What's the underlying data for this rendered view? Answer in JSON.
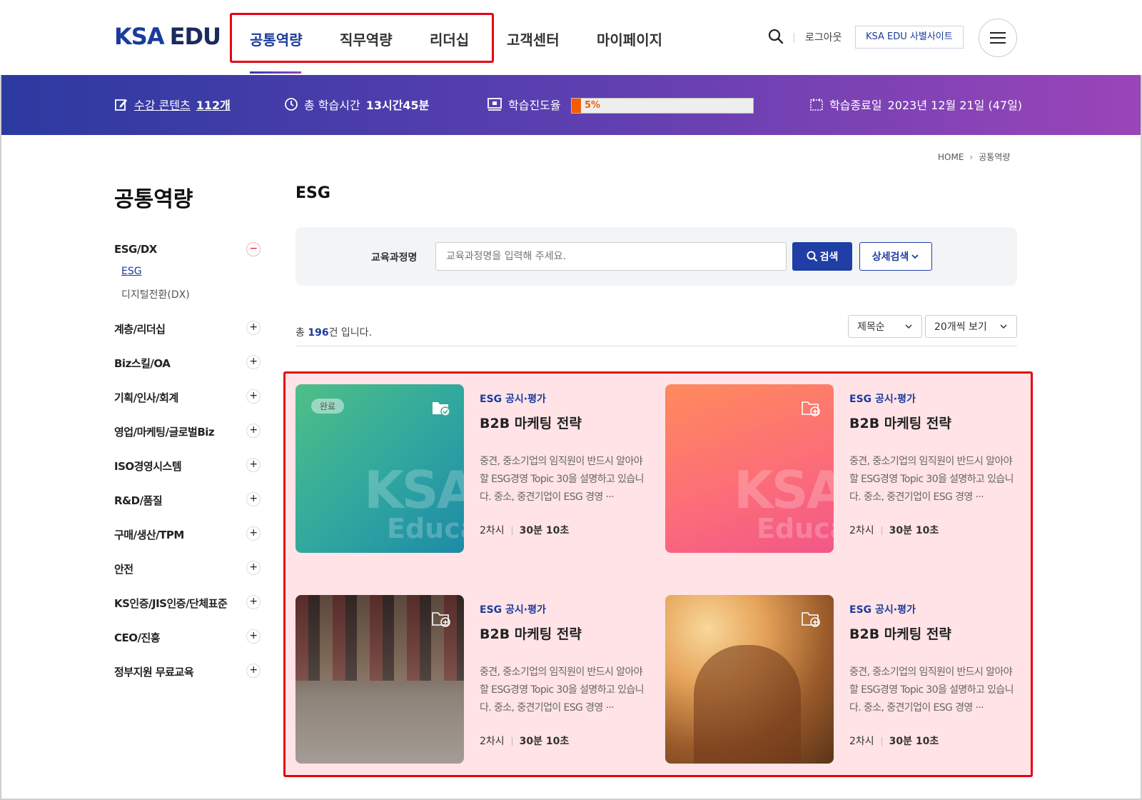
{
  "logo": {
    "ksa": "KSA",
    "edu": "EDU"
  },
  "gnb": [
    {
      "label": "공통역량",
      "active": true
    },
    {
      "label": "직무역량",
      "active": false
    },
    {
      "label": "리더십",
      "active": false
    },
    {
      "label": "고객센터",
      "active": false
    },
    {
      "label": "마이페이지",
      "active": false
    }
  ],
  "header": {
    "logout": "로그아웃",
    "family_site": "KSA EDU 사별사이트"
  },
  "banner": {
    "contents_label": "수강 콘텐츠",
    "contents_value": "112개",
    "time_label": "총 학습시간",
    "time_value": "13시간45분",
    "progress_label": "학습진도율",
    "progress_pct": "5%",
    "progress_value": 0.05,
    "end_label": "학습종료일",
    "end_value": "2023년 12월 21일 (47일)"
  },
  "breadcrumb": {
    "home": "HOME",
    "current": "공통역량"
  },
  "sidebar": {
    "title": "공통역량",
    "items": [
      {
        "label": "ESG/DX",
        "expanded": true,
        "subs": [
          {
            "label": "ESG",
            "on": true
          },
          {
            "label": "디지털전환(DX)",
            "on": false
          }
        ]
      },
      {
        "label": "계층/리더십"
      },
      {
        "label": "Biz스킬/OA"
      },
      {
        "label": "기획/인사/회계"
      },
      {
        "label": "영업/마케팅/글로벌Biz"
      },
      {
        "label": "ISO경영시스템"
      },
      {
        "label": "R&D/품질"
      },
      {
        "label": "구매/생산/TPM"
      },
      {
        "label": "안전"
      },
      {
        "label": "KS인증/JIS인증/단체표준"
      },
      {
        "label": "CEO/진흥"
      },
      {
        "label": "정부지원 무료교육"
      }
    ]
  },
  "main": {
    "title": "ESG",
    "search": {
      "label": "교육과정명",
      "placeholder": "교육과정명을 입력해 주세요.",
      "button": "검색",
      "advanced": "상세검색"
    },
    "total_prefix": "총 ",
    "total_count": "196",
    "total_suffix": "건 입니다.",
    "sort": "제목순",
    "per_page": "20개씩 보기"
  },
  "thumb_watermark": {
    "line1": "KSA",
    "line2": "Educa"
  },
  "cards": [
    {
      "category": "ESG 공시·평가",
      "title": "B2B 마케팅 전략",
      "desc": "중견, 중소기업의 임직원이 반드시 알아야 할 ESG경영 Topic 30을 설명하고 있습니다. 중소, 중견기업이 ESG 경영 ···",
      "sessions": "2차시",
      "duration": "30분 10초",
      "badge": "완료",
      "theme": "green"
    },
    {
      "category": "ESG 공시·평가",
      "title": "B2B 마케팅 전략",
      "desc": "중견, 중소기업의 임직원이 반드시 알아야 할 ESG경영 Topic 30을 설명하고 있습니다. 중소, 중견기업이 ESG 경영 ···",
      "sessions": "2차시",
      "duration": "30분 10초",
      "badge": "",
      "theme": "pink"
    },
    {
      "category": "ESG 공시·평가",
      "title": "B2B 마케팅 전략",
      "desc": "중견, 중소기업의 임직원이 반드시 알아야 할 ESG경영 Topic 30을 설명하고 있습니다. 중소, 중견기업이 ESG 경영 ···",
      "sessions": "2차시",
      "duration": "30분 10초",
      "badge": "",
      "theme": "photo-train"
    },
    {
      "category": "ESG 공시·평가",
      "title": "B2B 마케팅 전략",
      "desc": "중견, 중소기업의 임직원이 반드시 알아야 할 ESG경영 Topic 30을 설명하고 있습니다. 중소, 중견기업이 ESG 경영 ···",
      "sessions": "2차시",
      "duration": "30분 10초",
      "badge": "",
      "theme": "photo-sunset"
    }
  ],
  "colors": {
    "brand": "#1b3c9c",
    "accent": "#f25c05",
    "highlight": "#e60012"
  }
}
